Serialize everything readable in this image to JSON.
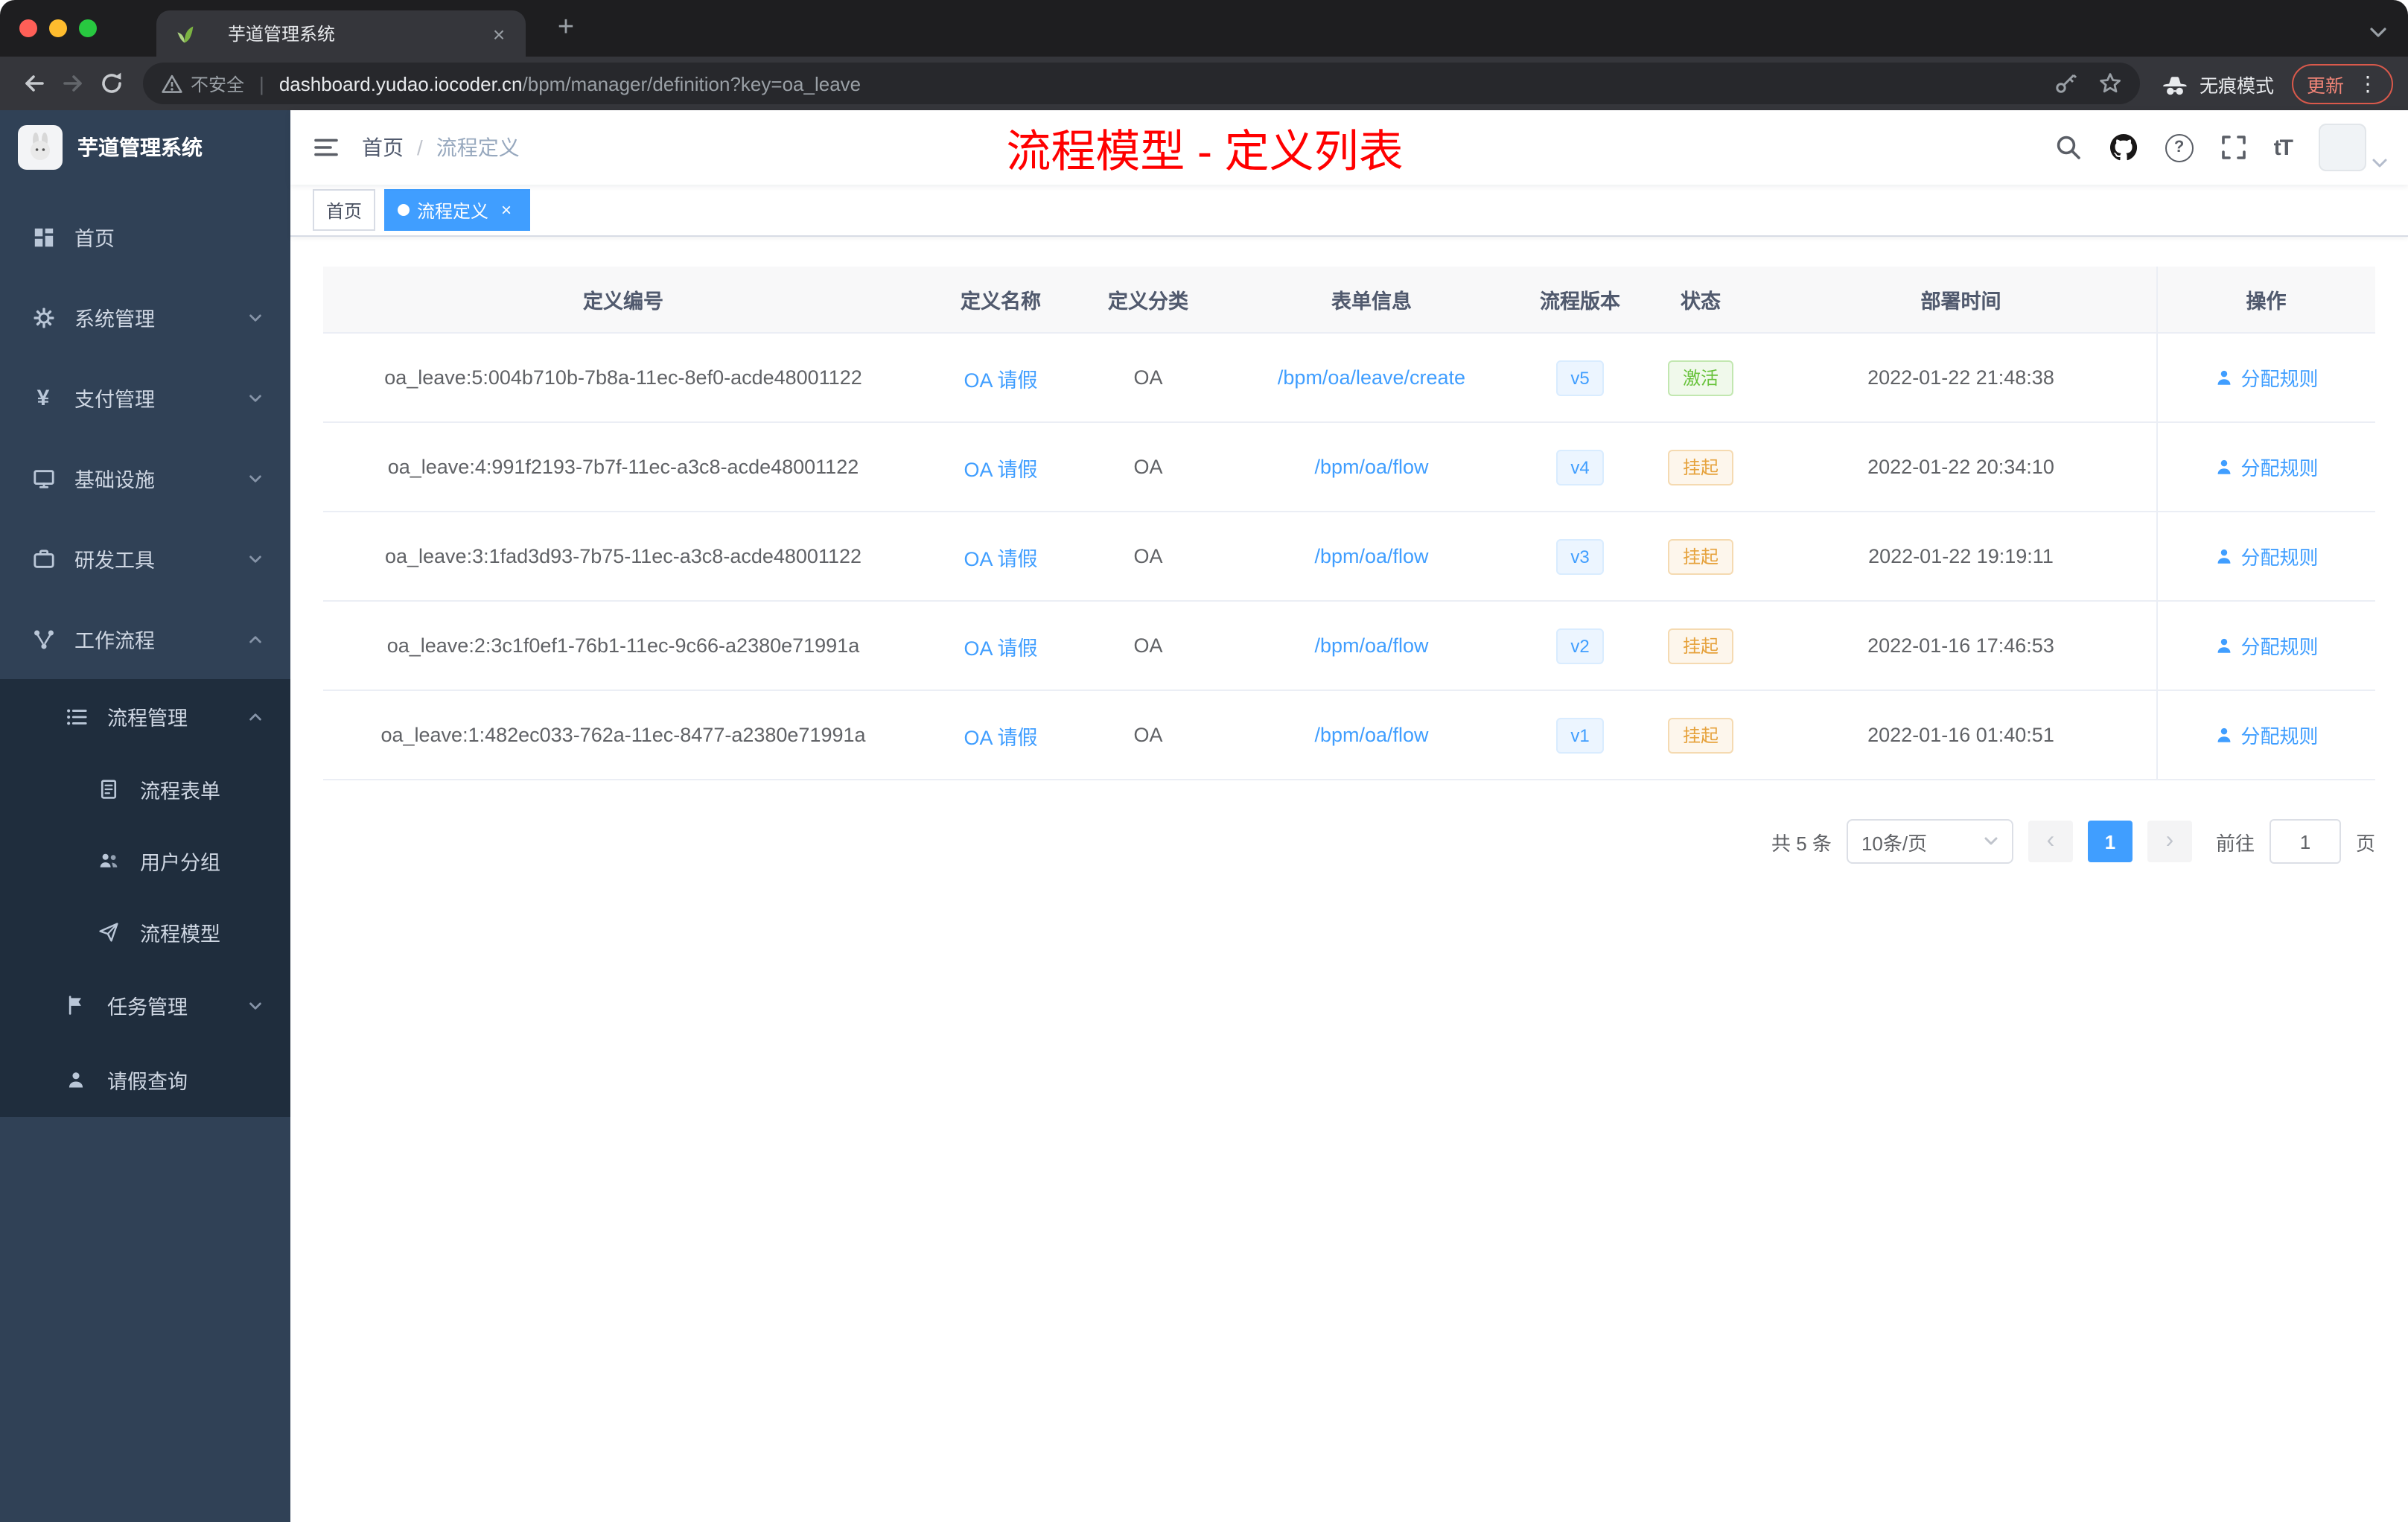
{
  "browser": {
    "tab_title": "芋道管理系统",
    "security_label": "不安全",
    "url_host": "dashboard.yudao.iocoder.cn",
    "url_path": "/bpm/manager/definition?key=oa_leave",
    "incognito_label": "无痕模式",
    "update_label": "更新"
  },
  "icons": {
    "close": "×",
    "plus": "+",
    "kebab": "⋮",
    "help": "?",
    "prev": "‹",
    "next": "›",
    "yen": "¥",
    "font_size": "tT",
    "url_separator": "|"
  },
  "sidebar": {
    "logo_title": "芋道管理系统",
    "items": [
      {
        "label": "首页"
      },
      {
        "label": "系统管理"
      },
      {
        "label": "支付管理"
      },
      {
        "label": "基础设施"
      },
      {
        "label": "研发工具"
      },
      {
        "label": "工作流程"
      },
      {
        "label": "流程管理"
      },
      {
        "label": "流程表单"
      },
      {
        "label": "用户分组"
      },
      {
        "label": "流程模型"
      },
      {
        "label": "任务管理"
      },
      {
        "label": "请假查询"
      }
    ]
  },
  "header": {
    "breadcrumb_home": "首页",
    "breadcrumb_separator": "/",
    "breadcrumb_current": "流程定义",
    "annotation": "流程模型 - 定义列表"
  },
  "tags": {
    "home": "首页",
    "current": "流程定义"
  },
  "table": {
    "columns": [
      "定义编号",
      "定义名称",
      "定义分类",
      "表单信息",
      "流程版本",
      "状态",
      "部署时间",
      "操作"
    ],
    "op_label": "分配规则",
    "rows": [
      {
        "id": "oa_leave:5:004b710b-7b8a-11ec-8ef0-acde48001122",
        "name": "OA 请假",
        "category": "OA",
        "form": "/bpm/oa/leave/create",
        "version": "v5",
        "status": "激活",
        "status_type": "active",
        "time": "2022-01-22 21:48:38"
      },
      {
        "id": "oa_leave:4:991f2193-7b7f-11ec-a3c8-acde48001122",
        "name": "OA 请假",
        "category": "OA",
        "form": "/bpm/oa/flow",
        "version": "v4",
        "status": "挂起",
        "status_type": "suspended",
        "time": "2022-01-22 20:34:10"
      },
      {
        "id": "oa_leave:3:1fad3d93-7b75-11ec-a3c8-acde48001122",
        "name": "OA 请假",
        "category": "OA",
        "form": "/bpm/oa/flow",
        "version": "v3",
        "status": "挂起",
        "status_type": "suspended",
        "time": "2022-01-22 19:19:11"
      },
      {
        "id": "oa_leave:2:3c1f0ef1-76b1-11ec-9c66-a2380e71991a",
        "name": "OA 请假",
        "category": "OA",
        "form": "/bpm/oa/flow",
        "version": "v2",
        "status": "挂起",
        "status_type": "suspended",
        "time": "2022-01-16 17:46:53"
      },
      {
        "id": "oa_leave:1:482ec033-762a-11ec-8477-a2380e71991a",
        "name": "OA 请假",
        "category": "OA",
        "form": "/bpm/oa/flow",
        "version": "v1",
        "status": "挂起",
        "status_type": "suspended",
        "time": "2022-01-16 01:40:51"
      }
    ]
  },
  "pagination": {
    "total": "共 5 条",
    "page_size": "10条/页",
    "current_page": "1",
    "goto_label": "前往",
    "goto_value": "1",
    "page_unit": "页"
  },
  "colors": {
    "accent": "#409eff",
    "sidebar_bg": "#304156",
    "submenu_bg": "#1f2d3d",
    "status_active": "#67c23a",
    "status_suspended": "#e6a23c",
    "annotation_red": "#ff0000"
  }
}
